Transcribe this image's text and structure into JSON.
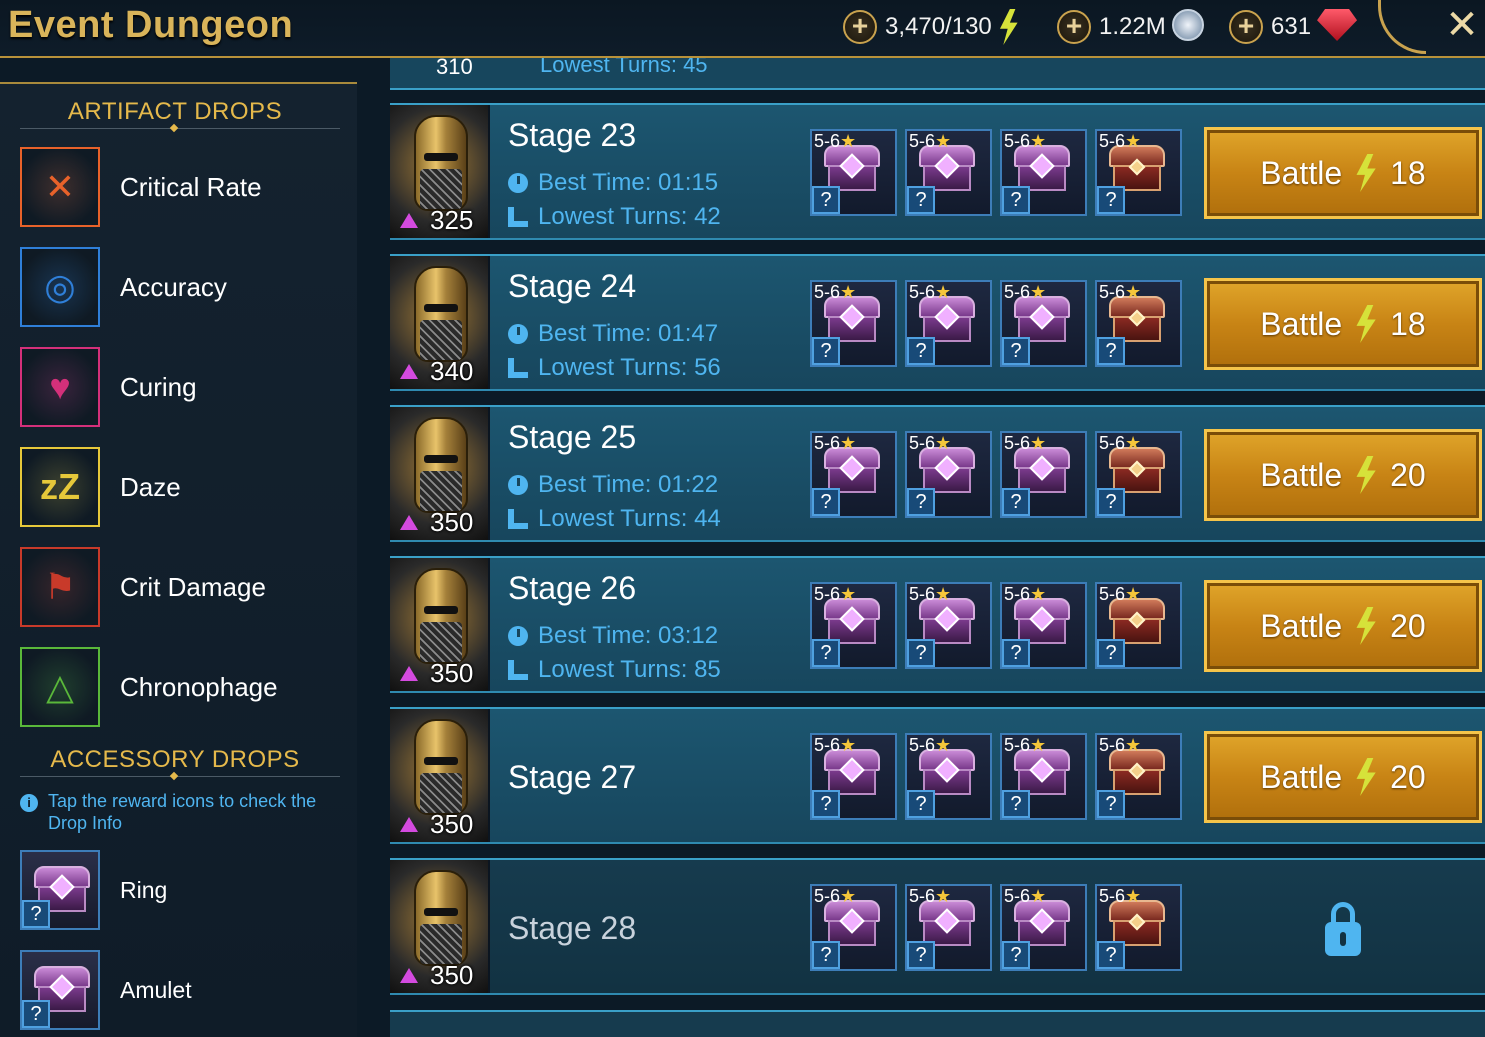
{
  "header": {
    "title": "Event Dungeon",
    "energy": "3,470/130",
    "silver": "1.22M",
    "gems": "631",
    "close_icon": "close-icon",
    "colors": {
      "accent": "#d9b45a",
      "energy_bolt": "#d6e23a"
    }
  },
  "sidebar": {
    "artifact_title": "ARTIFACT DROPS",
    "artifacts": [
      {
        "label": "Critical Rate",
        "icon": "crossed-swords-icon",
        "color": "#e8622a"
      },
      {
        "label": "Accuracy",
        "icon": "target-icon",
        "color": "#2f7fd8"
      },
      {
        "label": "Curing",
        "icon": "heart-plus-icon",
        "color": "#d4307a"
      },
      {
        "label": "Daze",
        "icon": "zzz-icon",
        "color": "#e6c83a"
      },
      {
        "label": "Crit Damage",
        "icon": "axe-icon",
        "color": "#c83a2a"
      },
      {
        "label": "Chronophage",
        "icon": "triangle-rings-icon",
        "color": "#5ab83a"
      }
    ],
    "accessory_title": "ACCESSORY DROPS",
    "info": "Tap the reward icons to check the Drop Info",
    "accessories": [
      {
        "label": "Ring",
        "q": "?"
      },
      {
        "label": "Amulet",
        "q": "?"
      }
    ]
  },
  "stages": {
    "partial_top": {
      "power": "310",
      "text": "Lowest Turns: 45"
    },
    "list": [
      {
        "name": "Stage 23",
        "power": "325",
        "best_time": "Best Time: 01:15",
        "lowest_turns": "Lowest Turns: 42",
        "battle": "Battle",
        "cost": "18",
        "locked": false
      },
      {
        "name": "Stage 24",
        "power": "340",
        "best_time": "Best Time: 01:47",
        "lowest_turns": "Lowest Turns: 56",
        "battle": "Battle",
        "cost": "18",
        "locked": false
      },
      {
        "name": "Stage 25",
        "power": "350",
        "best_time": "Best Time: 01:22",
        "lowest_turns": "Lowest Turns: 44",
        "battle": "Battle",
        "cost": "20",
        "locked": false
      },
      {
        "name": "Stage 26",
        "power": "350",
        "best_time": "Best Time: 03:12",
        "lowest_turns": "Lowest Turns: 85",
        "battle": "Battle",
        "cost": "20",
        "locked": false
      },
      {
        "name": "Stage 27",
        "power": "350",
        "best_time": "",
        "lowest_turns": "",
        "battle": "Battle",
        "cost": "20",
        "locked": false
      },
      {
        "name": "Stage 28",
        "power": "350",
        "best_time": "",
        "lowest_turns": "",
        "battle": "",
        "cost": "",
        "locked": true
      }
    ],
    "drop_rank": "5-6",
    "drop_q": "?"
  }
}
